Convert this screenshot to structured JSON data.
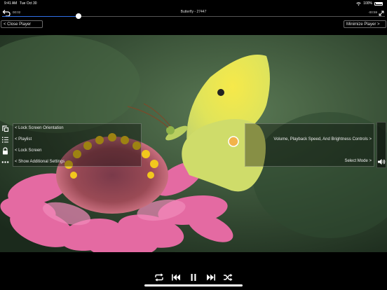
{
  "status_bar": {
    "time": "9:41 AM",
    "date": "Tue Oct 30",
    "battery": "100%"
  },
  "player": {
    "title": "Butterfly - 27447",
    "elapsed": "00:02",
    "remaining": "-00:59",
    "progress": 0.2
  },
  "buttons": {
    "close_player": "< Close Player",
    "minimize_player": "Minimize Player >"
  },
  "left_menu": {
    "items": [
      {
        "label": "< Lock Screen Orientation",
        "icon": "rotate-lock-icon"
      },
      {
        "label": "< Playlist",
        "icon": "list-icon"
      },
      {
        "label": "< Lock Screen",
        "icon": "lock-icon"
      },
      {
        "label": "< Show Additional Settings",
        "icon": "more-icon"
      }
    ]
  },
  "right_panel": {
    "label": "Volume, Playback Speed, And Brightness Controls >",
    "select_mode": "Select Mode >"
  },
  "colors": {
    "accent": "#2f6fe6",
    "background": "#000000"
  }
}
